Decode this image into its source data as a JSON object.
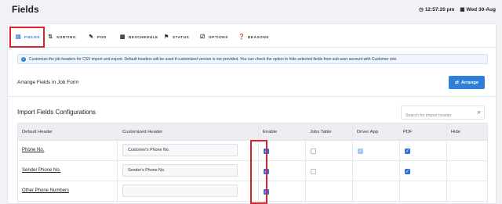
{
  "page": {
    "title": "Fields"
  },
  "clock": {
    "time": "12:57:20 pm",
    "date": "Wed 30-Aug",
    "time_icon": "clock-icon",
    "date_icon": "calendar-icon"
  },
  "tabs": [
    {
      "label": "FIELDS",
      "icon": "form-icon",
      "active": true
    },
    {
      "label": "SORTING",
      "icon": "sort-icon",
      "active": false
    },
    {
      "label": "POD",
      "icon": "edit-icon",
      "active": false
    },
    {
      "label": "RESCHEDULE",
      "icon": "calendar-icon",
      "active": false
    },
    {
      "label": "STATUS",
      "icon": "flag-icon",
      "active": false
    },
    {
      "label": "OPTIONS",
      "icon": "checkbox-icon",
      "active": false
    },
    {
      "label": "REASONS",
      "icon": "help-icon",
      "active": false
    }
  ],
  "info": {
    "text": "Customize the job headers for CSV import and export. Default headers will be used if customized version is not provided. You can check the option to hide selected fields from sub-user account with Customer role."
  },
  "arrange": {
    "label": "Arrange Fields in Job Form",
    "button_label": "Arrange"
  },
  "import_section": {
    "title": "Import Fields Configurations",
    "search_placeholder": "Search for import header"
  },
  "table": {
    "headers": {
      "default_header": "Default Header",
      "customized_header": "Customized Header",
      "enable": "Enable",
      "jobs_table": "Jobs Table",
      "driver_app": "Driver App",
      "pdf": "PDF",
      "hide": "Hide"
    },
    "rows": [
      {
        "default_header": "Phone No.",
        "customized_header": "Customer's Phone No.",
        "enable": true,
        "jobs_table": false,
        "driver_app": "checked-disabled",
        "pdf": true,
        "hide": ""
      },
      {
        "default_header": "Sender Phone No.",
        "customized_header": "Sender's Phone No.",
        "enable": true,
        "jobs_table": false,
        "driver_app": "",
        "pdf": true,
        "hide": ""
      },
      {
        "default_header": "Other Phone Numbers",
        "customized_header": "",
        "enable": true,
        "jobs_table": false,
        "driver_app": "",
        "pdf": "",
        "hide": ""
      }
    ]
  },
  "colors": {
    "accent": "#2f6fd6",
    "highlight": "#e0202f",
    "info_bg": "#eef5fc"
  }
}
